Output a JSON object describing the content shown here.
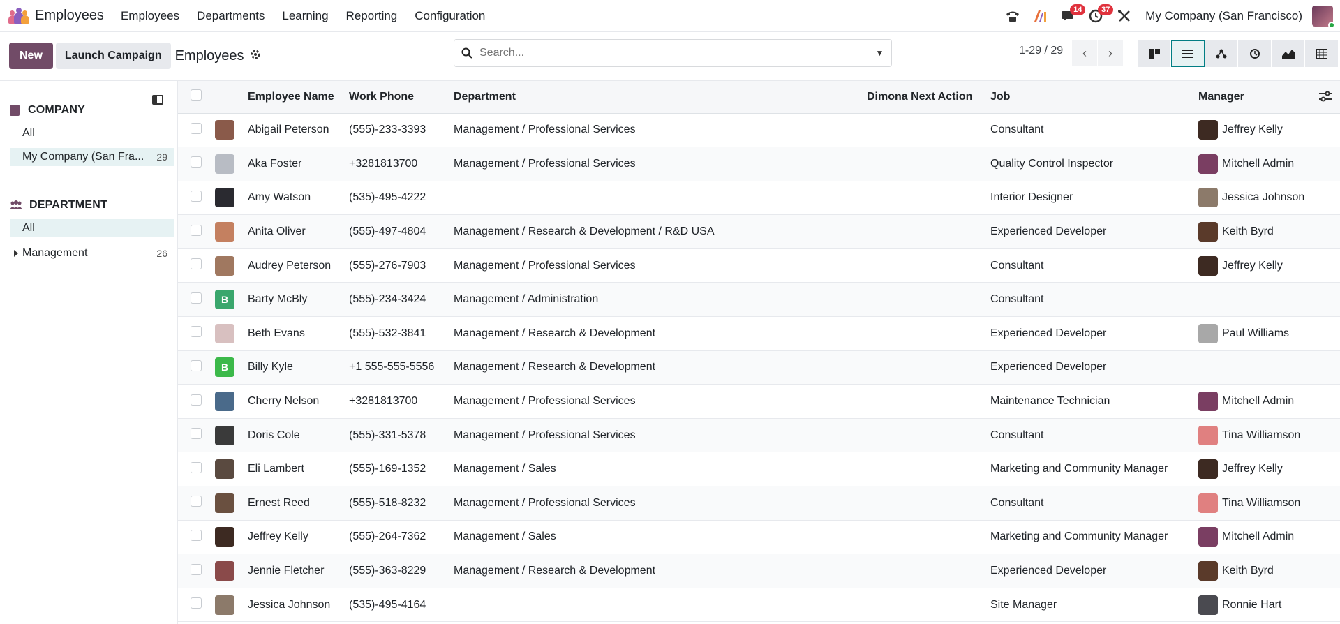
{
  "app": {
    "name": "Employees",
    "menu": [
      "Employees",
      "Departments",
      "Learning",
      "Reporting",
      "Configuration"
    ],
    "company": "My Company (San Francisco)",
    "badges": {
      "messages": "14",
      "activities": "37"
    }
  },
  "control": {
    "new_label": "New",
    "launch_label": "Launch Campaign",
    "title": "Employees",
    "search_placeholder": "Search...",
    "pager": "1-29 / 29"
  },
  "sidebar": {
    "company_header": "COMPANY",
    "company_items": [
      {
        "label": "All",
        "count": ""
      },
      {
        "label": "My Company (San Fra...",
        "count": "29"
      }
    ],
    "department_header": "DEPARTMENT",
    "department_items": [
      {
        "label": "All",
        "count": ""
      },
      {
        "label": "Management",
        "count": "26"
      }
    ]
  },
  "table": {
    "headers": [
      "Employee Name",
      "Work Phone",
      "Department",
      "Dimona Next Action",
      "Job",
      "Manager"
    ],
    "rows": [
      {
        "name": "Abigail Peterson",
        "phone": "(555)-233-3393",
        "dept": "Management / Professional Services",
        "job": "Consultant",
        "manager": "Jeffrey Kelly",
        "avatar": "#8a5a4a",
        "mgr_avatar": "#3d2a22"
      },
      {
        "name": "Aka Foster",
        "phone": "+3281813700",
        "dept": "Management / Professional Services",
        "job": "Quality Control Inspector",
        "manager": "Mitchell Admin",
        "avatar": "#b8bcc4",
        "mgr_avatar": "#7a3e62"
      },
      {
        "name": "Amy Watson",
        "phone": "(535)-495-4222",
        "dept": "",
        "job": "Interior Designer",
        "manager": "Jessica Johnson",
        "avatar": "#2a2a30",
        "mgr_avatar": "#8c7a6a"
      },
      {
        "name": "Anita Oliver",
        "phone": "(555)-497-4804",
        "dept": "Management / Research & Development / R&D USA",
        "job": "Experienced Developer",
        "manager": "Keith Byrd",
        "avatar": "#c48060",
        "mgr_avatar": "#5a3a2a"
      },
      {
        "name": "Audrey Peterson",
        "phone": "(555)-276-7903",
        "dept": "Management / Professional Services",
        "job": "Consultant",
        "manager": "Jeffrey Kelly",
        "avatar": "#a07860",
        "mgr_avatar": "#3d2a22"
      },
      {
        "name": "Barty McBly",
        "phone": "(555)-234-3424",
        "dept": "Management / Administration",
        "job": "Consultant",
        "manager": "",
        "avatar": "#3aa76d",
        "initial": "B",
        "mgr_avatar": ""
      },
      {
        "name": "Beth Evans",
        "phone": "(555)-532-3841",
        "dept": "Management / Research & Development",
        "job": "Experienced Developer",
        "manager": "Paul Williams",
        "avatar": "#d8c0c0",
        "mgr_avatar": "#a8a8a8"
      },
      {
        "name": "Billy Kyle",
        "phone": "+1 555-555-5556",
        "dept": "Management / Research & Development",
        "job": "Experienced Developer",
        "manager": "",
        "avatar": "#3cb94a",
        "initial": "B",
        "mgr_avatar": ""
      },
      {
        "name": "Cherry Nelson",
        "phone": "+3281813700",
        "dept": "Management / Professional Services",
        "job": "Maintenance Technician",
        "manager": "Mitchell Admin",
        "avatar": "#4a6a8a",
        "mgr_avatar": "#7a3e62"
      },
      {
        "name": "Doris Cole",
        "phone": "(555)-331-5378",
        "dept": "Management / Professional Services",
        "job": "Consultant",
        "manager": "Tina Williamson",
        "avatar": "#3a3a3a",
        "mgr_avatar": "#e08080"
      },
      {
        "name": "Eli Lambert",
        "phone": "(555)-169-1352",
        "dept": "Management / Sales",
        "job": "Marketing and Community Manager",
        "manager": "Jeffrey Kelly",
        "avatar": "#5a4a40",
        "mgr_avatar": "#3d2a22"
      },
      {
        "name": "Ernest Reed",
        "phone": "(555)-518-8232",
        "dept": "Management / Professional Services",
        "job": "Consultant",
        "manager": "Tina Williamson",
        "avatar": "#6a5040",
        "mgr_avatar": "#e08080"
      },
      {
        "name": "Jeffrey Kelly",
        "phone": "(555)-264-7362",
        "dept": "Management / Sales",
        "job": "Marketing and Community Manager",
        "manager": "Mitchell Admin",
        "avatar": "#3d2a22",
        "mgr_avatar": "#7a3e62"
      },
      {
        "name": "Jennie Fletcher",
        "phone": "(555)-363-8229",
        "dept": "Management / Research & Development",
        "job": "Experienced Developer",
        "manager": "Keith Byrd",
        "avatar": "#8a4a4a",
        "mgr_avatar": "#5a3a2a"
      },
      {
        "name": "Jessica Johnson",
        "phone": "(535)-495-4164",
        "dept": "",
        "job": "Site Manager",
        "manager": "Ronnie Hart",
        "avatar": "#8c7a6a",
        "mgr_avatar": "#4a4a50"
      }
    ]
  }
}
